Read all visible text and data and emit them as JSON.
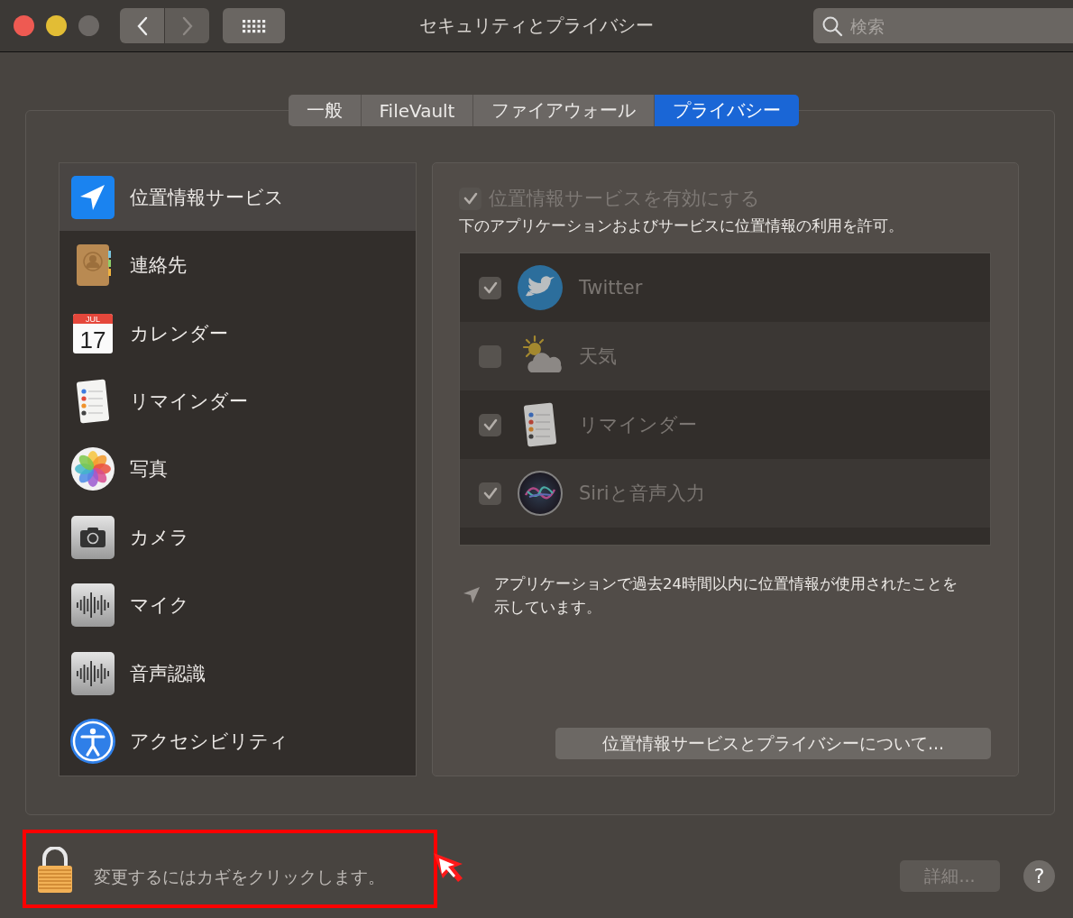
{
  "window": {
    "title": "セキュリティとプライバシー",
    "search": {
      "placeholder": "検索"
    }
  },
  "tabs": [
    {
      "label": "一般",
      "selected": false
    },
    {
      "label": "FileVault",
      "selected": false
    },
    {
      "label": "ファイアウォール",
      "selected": false
    },
    {
      "label": "プライバシー",
      "selected": true
    }
  ],
  "sidebar": {
    "items": [
      {
        "label": "位置情報サービス",
        "selected": true
      },
      {
        "label": "連絡先",
        "selected": false
      },
      {
        "label": "カレンダー",
        "selected": false,
        "icon_month": "JUL",
        "icon_day": "17"
      },
      {
        "label": "リマインダー",
        "selected": false
      },
      {
        "label": "写真",
        "selected": false
      },
      {
        "label": "カメラ",
        "selected": false
      },
      {
        "label": "マイク",
        "selected": false
      },
      {
        "label": "音声認識",
        "selected": false
      },
      {
        "label": "アクセシビリティ",
        "selected": false
      }
    ]
  },
  "location": {
    "enable": {
      "label": "位置情報サービスを有効にする",
      "checked": true,
      "disabled": true
    },
    "description": "下のアプリケーションおよびサービスに位置情報の利用を許可。",
    "apps": [
      {
        "name": "Twitter",
        "checked": true,
        "disabled": true
      },
      {
        "name": "天気",
        "checked": false,
        "disabled": true
      },
      {
        "name": "リマインダー",
        "checked": true,
        "disabled": true
      },
      {
        "name": "Siriと音声入力",
        "checked": true,
        "disabled": true
      }
    ],
    "note": "アプリケーションで過去24時間以内に位置情報が使用されたことを示しています。",
    "about_button": "位置情報サービスとプライバシーについて..."
  },
  "bottom": {
    "lock_text": "変更するにはカギをクリックします。",
    "highlighted": true,
    "details_button": {
      "label": "詳細...",
      "disabled": true
    },
    "help_button": "?"
  }
}
